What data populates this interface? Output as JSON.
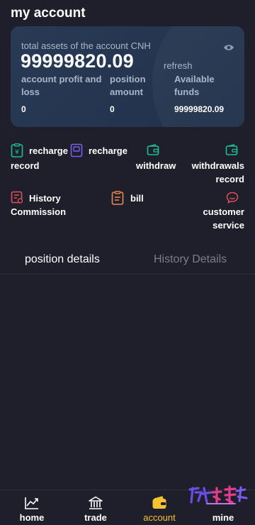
{
  "header": {
    "title": "my account"
  },
  "assets": {
    "label": "total assets of the account CNH",
    "value": "99999820.09",
    "refresh_label": "refresh",
    "stats": [
      {
        "label_line1": "account profit and",
        "label_line2": "loss",
        "value": "0"
      },
      {
        "label_line1": "position",
        "label_line2": "amount",
        "value": "0"
      },
      {
        "label_line1": "Available",
        "label_line2": "funds",
        "value": "99999820.09"
      }
    ]
  },
  "menu": {
    "recharge_record": {
      "line1": "recharge",
      "line2": "record"
    },
    "recharge": {
      "label": "recharge"
    },
    "withdraw": {
      "label": "withdraw"
    },
    "withdrawals_record": {
      "line1": "withdrawals",
      "line2": "record"
    },
    "history_commission": {
      "line1": "History",
      "line2": "Commission"
    },
    "bill": {
      "label": "bill"
    },
    "customer_service": {
      "line1": "customer",
      "line2": "service"
    }
  },
  "tabs": {
    "position_details": "position details",
    "history_details": "History Details"
  },
  "nav": {
    "home": "home",
    "trade": "trade",
    "account": "account",
    "mine": "mine"
  },
  "colors": {
    "background": "#1f1f2b",
    "card": "#283a55",
    "accent_green": "#1fbf8f",
    "accent_purple": "#7b5cf0",
    "accent_orange": "#e9884a",
    "accent_red": "#e0505c",
    "nav_active": "#f5c330"
  },
  "icons": {
    "eye": "eye-icon",
    "recharge_record": "yuan-receipt-icon",
    "recharge": "wallet-card-icon",
    "withdraw": "wallet-icon",
    "withdrawals_record": "wallet-record-icon",
    "history_commission": "commission-icon",
    "bill": "bill-icon",
    "customer_service": "chat-icon"
  }
}
